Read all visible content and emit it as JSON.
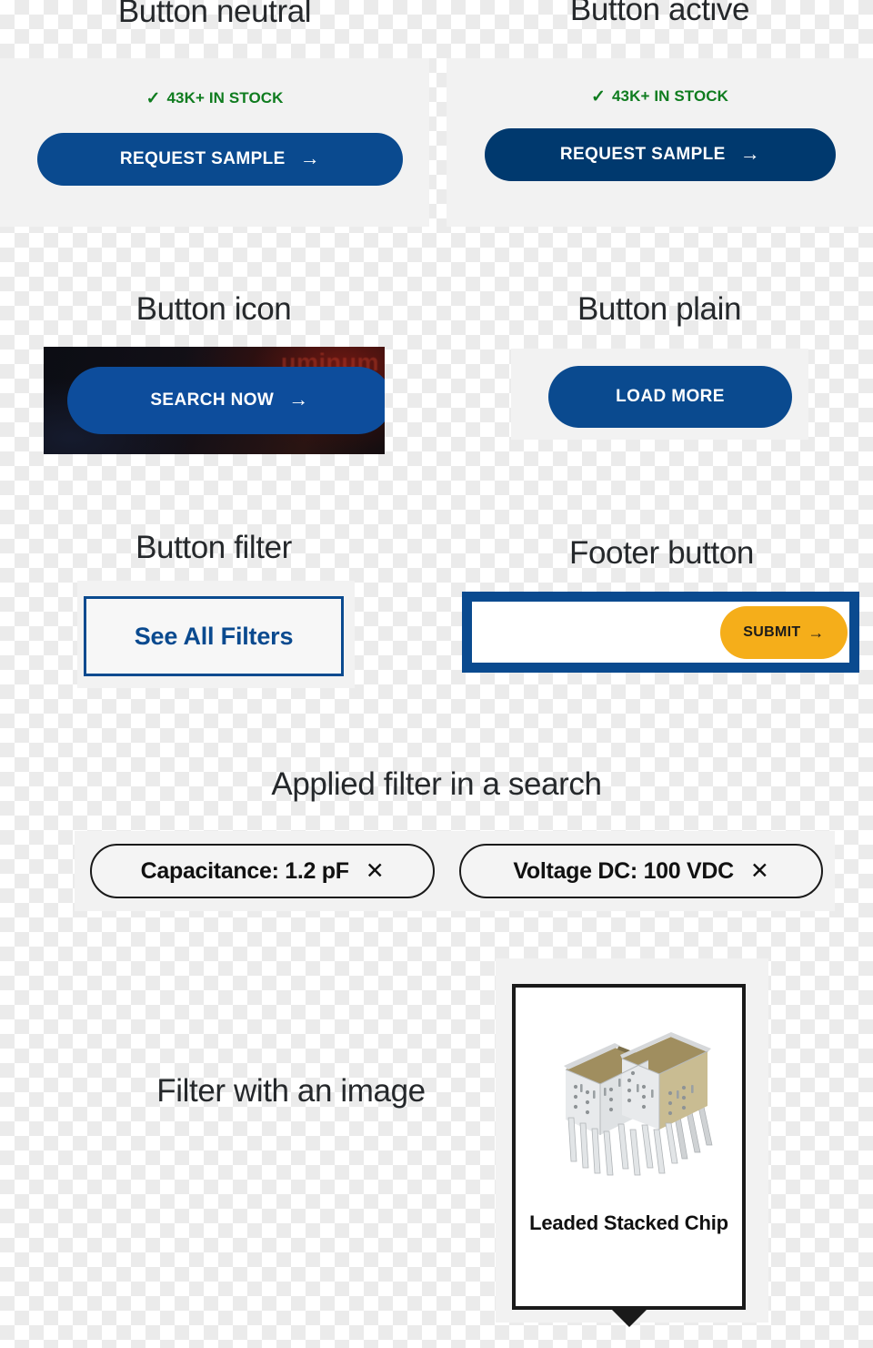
{
  "sections": {
    "button_neutral": {
      "heading": "Button neutral",
      "stock_text": "43K+ IN STOCK",
      "check_icon": "check-icon",
      "button_label": "REQUEST SAMPLE",
      "button_arrow": "→",
      "button_color": "#0a4a8f"
    },
    "button_active": {
      "heading": "Button active",
      "stock_text": "43K+ IN STOCK",
      "check_icon": "check-icon",
      "button_label": "REQUEST SAMPLE",
      "button_arrow": "→",
      "button_color": "#00396e"
    },
    "button_icon": {
      "heading": "Button icon",
      "button_label": "SEARCH NOW",
      "button_arrow": "→",
      "background_ghost_text": "uminum",
      "button_color": "#0d4d9c"
    },
    "button_plain": {
      "heading": "Button plain",
      "button_label": "LOAD MORE",
      "button_color": "#0a4a8f"
    },
    "button_filter": {
      "heading": "Button filter",
      "button_label": "See All Filters",
      "border_color": "#0a4a8f",
      "text_color": "#0a4a8f"
    },
    "footer_button": {
      "heading": "Footer button",
      "input_value": "",
      "input_placeholder": "",
      "submit_label": "SUBMIT",
      "submit_arrow": "→",
      "submit_color": "#f5ae1a",
      "border_color": "#0a4a8f"
    },
    "applied_filters": {
      "heading": "Applied filter in a search",
      "chips": [
        {
          "label": "Capacitance: 1.2 pF",
          "remove_icon": "✕"
        },
        {
          "label": "Voltage DC: 100 VDC",
          "remove_icon": "✕"
        }
      ]
    },
    "filter_with_image": {
      "heading": "Filter with an image",
      "card": {
        "caption": "Leaded Stacked Chip",
        "image_name": "leaded-stacked-chip-image"
      }
    }
  },
  "colors": {
    "brand_blue": "#0a4a8f",
    "brand_blue_active": "#00396e",
    "accent_amber": "#f5ae1a",
    "stock_green": "#0f7c1f",
    "panel_gray": "#f2f2f2",
    "text_dark": "#25282b"
  }
}
